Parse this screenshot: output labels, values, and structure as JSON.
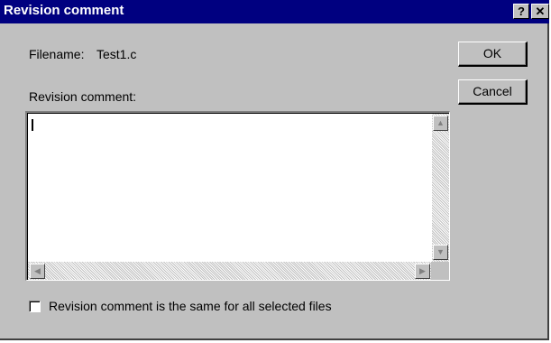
{
  "window": {
    "title": "Revision comment",
    "help_glyph": "?",
    "close_glyph": "✕"
  },
  "filename": {
    "label": "Filename:",
    "value": "Test1.c"
  },
  "revision": {
    "label": "Revision comment:",
    "value": ""
  },
  "buttons": {
    "ok": "OK",
    "cancel": "Cancel"
  },
  "scrollbar": {
    "up": "▲",
    "down": "▼",
    "left": "◀",
    "right": "▶"
  },
  "option": {
    "label": "Revision comment is the same for all selected files",
    "checked": false
  },
  "colors": {
    "titlebar": "#000080",
    "face": "#c0c0c0"
  }
}
